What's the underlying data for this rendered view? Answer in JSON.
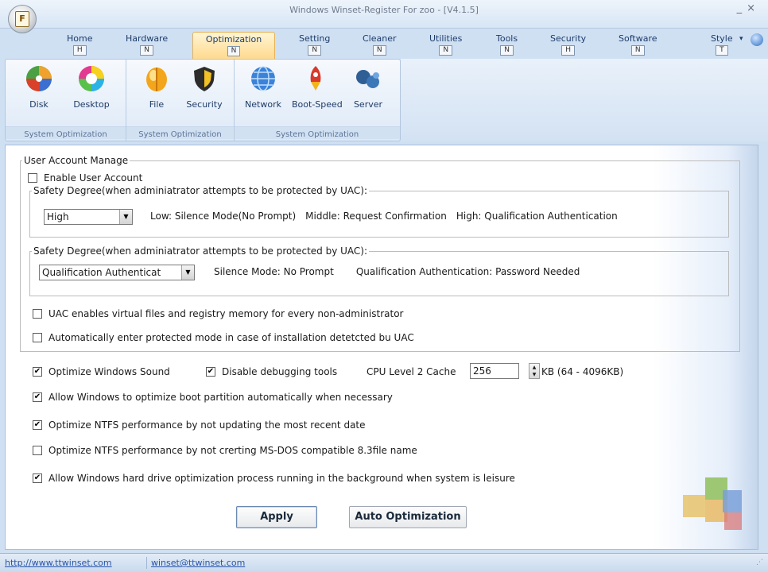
{
  "window": {
    "title": "Windows Winset-Register For zoo - [V4.1.5]",
    "minimize": "_",
    "close": "×"
  },
  "app_button": {
    "icon": "app-logo-icon"
  },
  "tabs": [
    {
      "label": "Home",
      "key": "H"
    },
    {
      "label": "Hardware",
      "key": "N"
    },
    {
      "label": "Optimization",
      "key": "N"
    },
    {
      "label": "Setting",
      "key": "N"
    },
    {
      "label": "Cleaner",
      "key": "N"
    },
    {
      "label": "Utilities",
      "key": "N"
    },
    {
      "label": "Tools",
      "key": "N"
    },
    {
      "label": "Security",
      "key": "H"
    },
    {
      "label": "Software",
      "key": "N"
    },
    {
      "label": "Style",
      "key": "T"
    }
  ],
  "active_tab": "Optimization",
  "ribbon": {
    "groups": [
      {
        "label": "System Optimization",
        "buttons": [
          "Disk",
          "Desktop"
        ]
      },
      {
        "label": "System Optimization",
        "buttons": [
          "File",
          "Security"
        ]
      },
      {
        "label": "System Optimization",
        "buttons": [
          "Network",
          "Boot-Speed",
          "Server"
        ]
      }
    ]
  },
  "uac": {
    "legend": "User Account Manage",
    "enable_label": "Enable User Account",
    "enable_checked": false,
    "admin": {
      "legend": "Safety Degree(when adminiatrator attempts to be protected by UAC):",
      "selected": "High",
      "desc_low": "Low: Silence Mode(No Prompt)",
      "desc_middle": "Middle: Request Confirmation",
      "desc_high": "High: Qualification Authentication"
    },
    "standard": {
      "legend": "Safety Degree(when adminiatrator attempts to be protected by UAC):",
      "selected": "Qualification Authenticat",
      "desc_silence": "Silence Mode: No Prompt",
      "desc_qual": "Qualification Authentication: Password Needed"
    },
    "virtual_label": "UAC enables virtual files and registry memory for every non-administrator",
    "virtual_checked": false,
    "protected_label": "Automatically enter protected mode in case of installation detetcted bu UAC",
    "protected_checked": false
  },
  "options": {
    "sound_label": "Optimize Windows Sound",
    "sound_checked": true,
    "debug_label": "Disable debugging tools",
    "debug_checked": true,
    "cache_label": "CPU Level 2 Cache",
    "cache_value": "256",
    "cache_unit": "KB (64 - 4096KB)",
    "boot_label": "Allow Windows to optimize boot partition automatically when necessary",
    "boot_checked": true,
    "ntfs_date_label": "Optimize NTFS performance by not updating the most recent date",
    "ntfs_date_checked": true,
    "ntfs_dos_label": "Optimize NTFS performance by not crerting MS-DOS compatible 8.3file name",
    "ntfs_dos_checked": false,
    "hdd_label": "Allow Windows hard drive optimization process running in the background when system is leisure",
    "hdd_checked": true
  },
  "buttons": {
    "apply": "Apply",
    "auto": "Auto Optimization"
  },
  "status": {
    "url": "http://www.ttwinset.com",
    "email": "winset@ttwinset.com"
  }
}
